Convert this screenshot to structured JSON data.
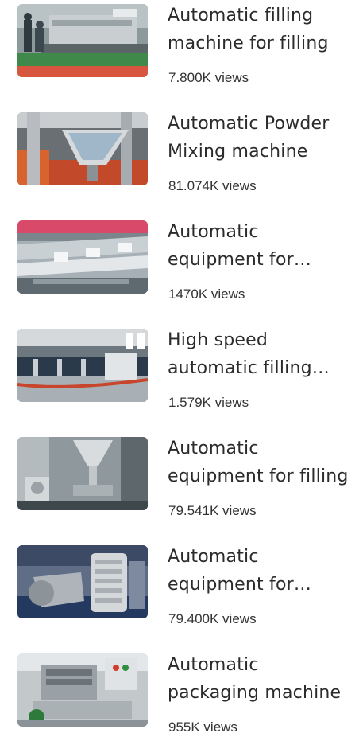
{
  "videos": [
    {
      "title": "Automatic filling machine for filling",
      "views": "7.800K views",
      "thumb_icon": "filling-machine-line-thumbnail"
    },
    {
      "title": "Automatic Powder Mixing machine",
      "views": "81.074K views",
      "thumb_icon": "powder-mixer-hopper-thumbnail"
    },
    {
      "title": "Automatic equipment for packaging",
      "views": "1470K views",
      "thumb_icon": "packaging-conveyor-thumbnail"
    },
    {
      "title": "High speed automatic filling machine",
      "views": "1.579K views",
      "thumb_icon": "bottle-filling-line-thumbnail"
    },
    {
      "title": "Automatic equipment for filling",
      "views": "79.541K views",
      "thumb_icon": "filling-funnel-machine-thumbnail"
    },
    {
      "title": "Automatic equipment for mixing",
      "views": "79.400K views",
      "thumb_icon": "spiral-mixer-thumbnail"
    },
    {
      "title": "Automatic packaging machine",
      "views": "955K views",
      "thumb_icon": "packaging-press-thumbnail"
    }
  ]
}
